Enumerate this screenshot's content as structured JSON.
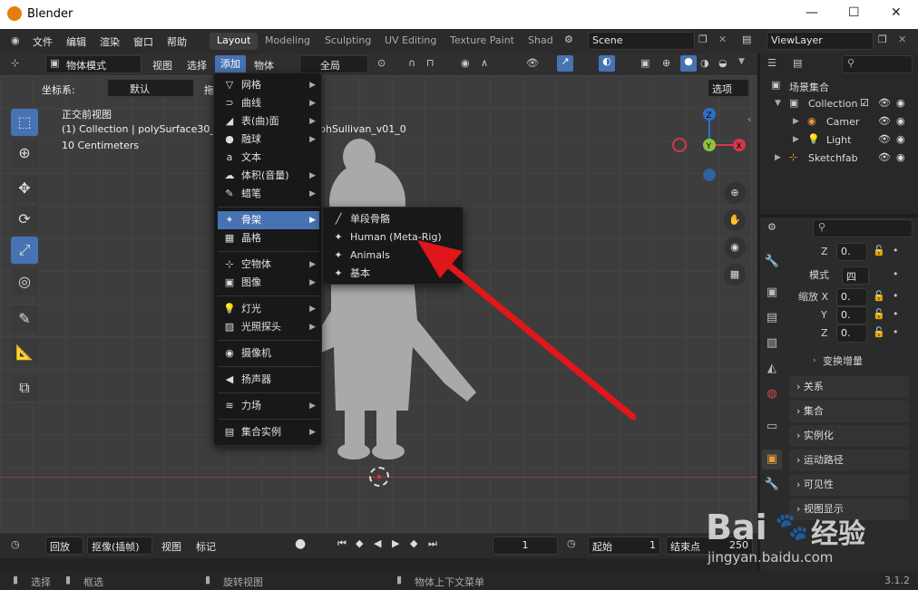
{
  "window": {
    "title": "Blender"
  },
  "topmenu": [
    "文件",
    "编辑",
    "渲染",
    "窗口",
    "帮助"
  ],
  "workspaces": [
    "Layout",
    "Modeling",
    "Sculpting",
    "UV Editing",
    "Texture Paint",
    "Shad"
  ],
  "scene": "Scene",
  "view_layer": "ViewLayer",
  "toolbar": {
    "mode": "物体模式",
    "view": "视图",
    "select": "选择",
    "add": "添加",
    "object": "物体",
    "transform_orient": "全局"
  },
  "header2": {
    "coord_label": "坐标系:",
    "coord_value": "默认",
    "drag": "拖",
    "options": "选项"
  },
  "viewport": {
    "view_name": "正交前视图",
    "collection_info": "(1) Collection | polySurface30_0_",
    "collection_suffix": "phSullivan_v01_0",
    "scale": "10 Centimeters"
  },
  "add_menu": [
    {
      "label": "网格",
      "icon": "▽"
    },
    {
      "label": "曲线",
      "icon": "⊃"
    },
    {
      "label": "表(曲)面",
      "icon": "◢"
    },
    {
      "label": "融球",
      "icon": "●"
    },
    {
      "label": "文本",
      "icon": "a"
    },
    {
      "label": "体积(音量)",
      "icon": "☁"
    },
    {
      "label": "蜡笔",
      "icon": "✎"
    },
    {
      "label": "骨架",
      "icon": "✦"
    },
    {
      "label": "晶格",
      "icon": "▦"
    },
    {
      "label": "空物体",
      "icon": "⊹"
    },
    {
      "label": "图像",
      "icon": "▣"
    },
    {
      "label": "灯光",
      "icon": "💡"
    },
    {
      "label": "光照探头",
      "icon": "▨"
    },
    {
      "label": "摄像机",
      "icon": "◉"
    },
    {
      "label": "扬声器",
      "icon": "◀"
    },
    {
      "label": "力场",
      "icon": "≋"
    },
    {
      "label": "集合实例",
      "icon": "▤"
    }
  ],
  "armature_submenu": [
    {
      "label": "单段骨骼",
      "icon": "╱"
    },
    {
      "label": "Human (Meta-Rig)",
      "icon": "✦"
    },
    {
      "label": "Animals",
      "icon": "✦"
    },
    {
      "label": "基本",
      "icon": "✦"
    }
  ],
  "outliner": {
    "root": "场景集合",
    "items": [
      "Collection",
      "Camer",
      "Light",
      "Sketchfab"
    ]
  },
  "props": {
    "z1_label": "Z",
    "z1_val": "0.",
    "mode_label": "模式",
    "mode_val": "四",
    "scale_label": "缩放 X",
    "sx": "0.",
    "y_label": "Y",
    "sy": "0.",
    "z_label": "Z",
    "sz": "0.",
    "delta": "变换增量",
    "panels": [
      "关系",
      "集合",
      "实例化",
      "运动路径",
      "可见性",
      "视图显示"
    ]
  },
  "timeline": {
    "playback": "回放",
    "keying": "抠像(插帧)",
    "view": "视图",
    "marker": "标记",
    "frame": "1",
    "start_label": "起始",
    "start": "1",
    "end_label": "结束点",
    "end": "250"
  },
  "status": {
    "select": "选择",
    "box": "框选",
    "rotate": "旋转视图",
    "context": "物体上下文菜单",
    "version": "3.1.2"
  },
  "watermark": {
    "line1": "Bai",
    "line2": "经验",
    "url": "jingyan.baidu.com"
  },
  "colors": {
    "accent": "#4772b3",
    "arrow": "#e0161b",
    "axis_x": "#d9364a",
    "axis_y": "#8cc43a",
    "axis_z": "#2f6fc9"
  }
}
